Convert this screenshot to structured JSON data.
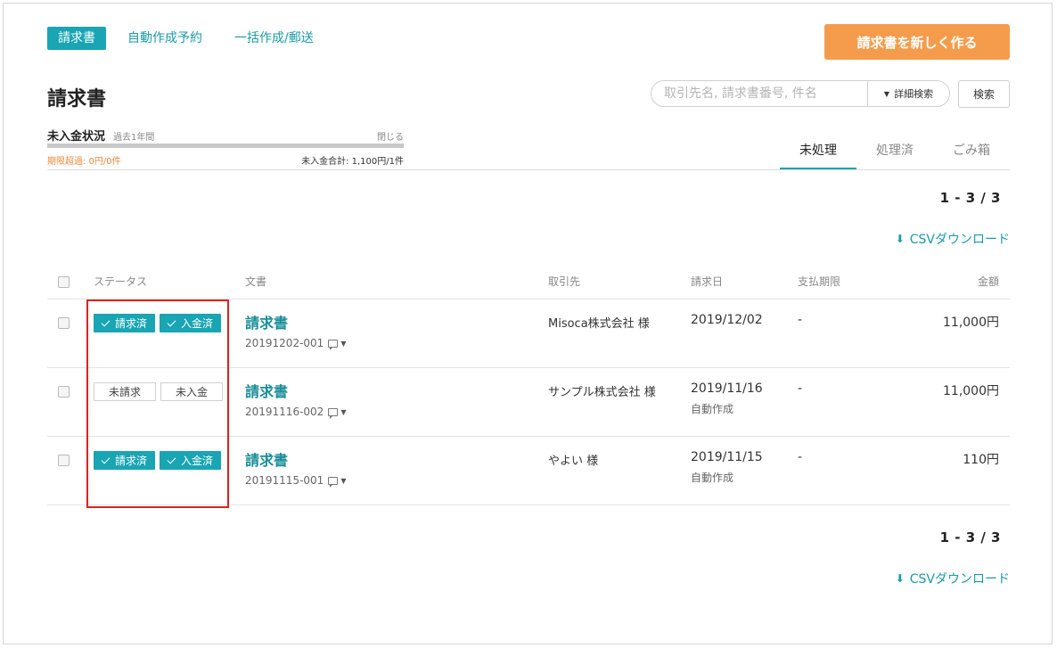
{
  "nav": {
    "tabs": [
      {
        "label": "請求書",
        "active": true
      },
      {
        "label": "自動作成予約",
        "active": false
      },
      {
        "label": "一括作成/郵送",
        "active": false
      }
    ],
    "new_button": "請求書を新しく作る"
  },
  "page_title": "請求書",
  "search": {
    "placeholder": "取引先名, 請求書番号, 件名",
    "advanced_label": "詳細検索",
    "button": "検索"
  },
  "unpaid_status": {
    "title": "未入金状況",
    "period": "過去1年間",
    "close": "閉じる",
    "overdue": "期限超過: 0円/0件",
    "total": "未入金合計: 1,100円/1件"
  },
  "status_tabs": [
    "未処理",
    "処理済",
    "ごみ箱"
  ],
  "pagination": "1 - 3 / 3",
  "csv_label": "CSVダウンロード",
  "table": {
    "headers": {
      "status": "ステータス",
      "doc": "文書",
      "client": "取引先",
      "date": "請求日",
      "due": "支払期限",
      "amount": "金額"
    },
    "rows": [
      {
        "billed": "請求済",
        "paid": "入金済",
        "doc_title": "請求書",
        "doc_no": "20191202-001",
        "client": "Misoca株式会社 様",
        "date": "2019/12/02",
        "date_note": "",
        "due": "-",
        "amount": "11,000円"
      },
      {
        "billed": "未請求",
        "paid": "未入金",
        "doc_title": "請求書",
        "doc_no": "20191116-002",
        "client": "サンプル株式会社 様",
        "date": "2019/11/16",
        "date_note": "自動作成",
        "due": "-",
        "amount": "11,000円"
      },
      {
        "billed": "請求済",
        "paid": "入金済",
        "doc_title": "請求書",
        "doc_no": "20191115-001",
        "client": "やよい 様",
        "date": "2019/11/15",
        "date_note": "自動作成",
        "due": "-",
        "amount": "110円"
      }
    ]
  },
  "colors": {
    "accent": "#19a5b3",
    "orange": "#f59c4c",
    "highlight": "#e02020"
  }
}
